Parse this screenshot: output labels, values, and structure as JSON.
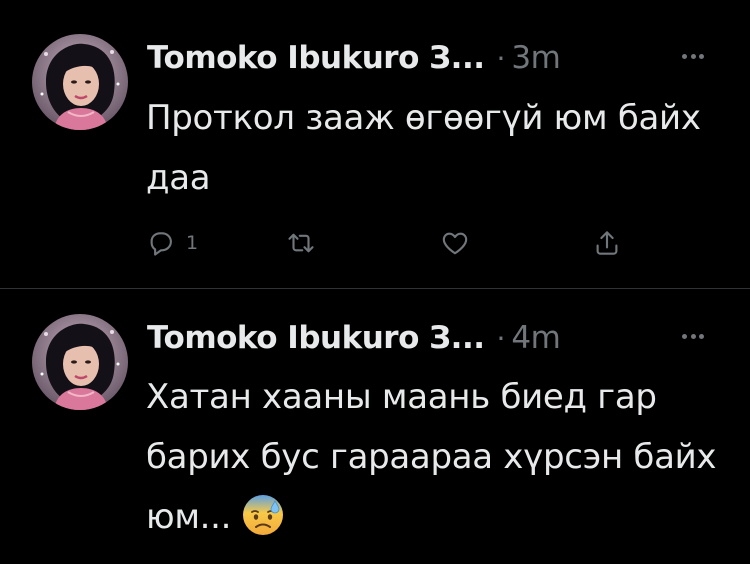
{
  "tweets": [
    {
      "author_name": "Tomoko Ibukuro З...",
      "separator": "·",
      "time": "3m",
      "text": "Проткол зааж өгөөгүй юм байх даа",
      "reply_count": "1",
      "avatar_icon": "avatar-photo",
      "more_icon": "more-horizontal-icon"
    },
    {
      "author_name": "Tomoko Ibukuro З...",
      "separator": "·",
      "time": "4m",
      "text": "Хатан хааны маань биед гар барих бус гараараа хүрсэн байх юм...",
      "emoji": "anxious-face-with-sweat-emoji",
      "more_icon": "more-horizontal-icon"
    }
  ],
  "colors": {
    "background": "#000000",
    "text_primary": "#e7e9ea",
    "text_secondary": "#71767b",
    "divider": "#2f3336"
  }
}
